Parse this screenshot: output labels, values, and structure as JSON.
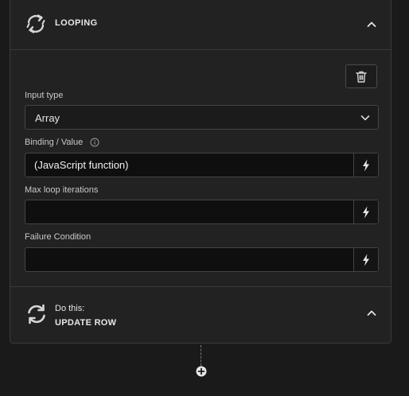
{
  "loop_step": {
    "title": "LOOPING",
    "icon": "refresh-cycle-icon",
    "collapse_icon": "chevron-up-icon"
  },
  "form": {
    "delete_icon": "trash-icon",
    "input_type": {
      "label": "Input type",
      "value": "Array"
    },
    "binding": {
      "label": "Binding / Value",
      "value": "(JavaScript function)"
    },
    "max_iterations": {
      "label": "Max loop iterations",
      "value": ""
    },
    "failure_condition": {
      "label": "Failure Condition",
      "value": ""
    }
  },
  "child_step": {
    "label": "Do this:",
    "action": "UPDATE ROW",
    "icon": "sync-icon"
  },
  "add_step_icon": "plus-circle-icon",
  "colors": {
    "background": "#1a1a1a",
    "card": "#222222",
    "border": "#3a3a3a",
    "input_bg": "#0f0f0f"
  }
}
